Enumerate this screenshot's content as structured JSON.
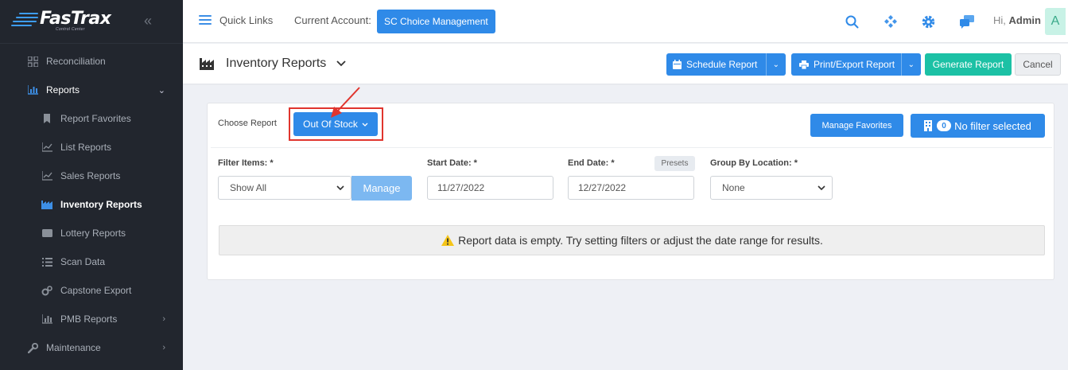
{
  "brand": {
    "name": "FasTrax",
    "tagline": "Control Center"
  },
  "sidebar": {
    "items": [
      {
        "label": "Reconciliation",
        "icon": "grid-icon"
      },
      {
        "label": "Reports",
        "icon": "bar-chart-icon"
      },
      {
        "label": "Report Favorites",
        "icon": "bookmark-icon"
      },
      {
        "label": "List Reports",
        "icon": "line-chart-icon"
      },
      {
        "label": "Sales Reports",
        "icon": "line-chart-icon"
      },
      {
        "label": "Inventory Reports",
        "icon": "factory-icon",
        "active": true
      },
      {
        "label": "Lottery Reports",
        "icon": "ticket-icon"
      },
      {
        "label": "Scan Data",
        "icon": "list-icon"
      },
      {
        "label": "Capstone Export",
        "icon": "cogs-icon"
      },
      {
        "label": "PMB Reports",
        "icon": "bar-chart-icon"
      },
      {
        "label": "Maintenance",
        "icon": "wrench-icon"
      }
    ]
  },
  "header": {
    "quick_links": "Quick Links",
    "current_account_label": "Current Account:",
    "current_account": "SC Choice Management",
    "greeting_prefix": "Hi,",
    "user": "Admin",
    "avatar_letter": "A"
  },
  "subheader": {
    "title": "Inventory Reports",
    "schedule": "Schedule Report",
    "print_export": "Print/Export Report",
    "generate": "Generate Report",
    "cancel": "Cancel"
  },
  "report": {
    "choose_label": "Choose Report",
    "selected": "Out Of Stock",
    "manage_favorites": "Manage Favorites",
    "filter_count": "0",
    "filter_text": "No filter selected"
  },
  "filters": {
    "items_label": "Filter Items: *",
    "items_value": "Show All",
    "manage": "Manage",
    "start_label": "Start Date: *",
    "start_value": "11/27/2022",
    "end_label": "End Date: *",
    "end_value": "12/27/2022",
    "presets": "Presets",
    "group_label": "Group By Location: *",
    "group_value": "None"
  },
  "alert": {
    "message": "Report data is empty. Try setting filters or adjust the date range for results."
  },
  "colors": {
    "primary": "#2f8ae8",
    "success": "#1cc1a5",
    "sidebar": "#22262e",
    "highlight": "#e0352e"
  }
}
